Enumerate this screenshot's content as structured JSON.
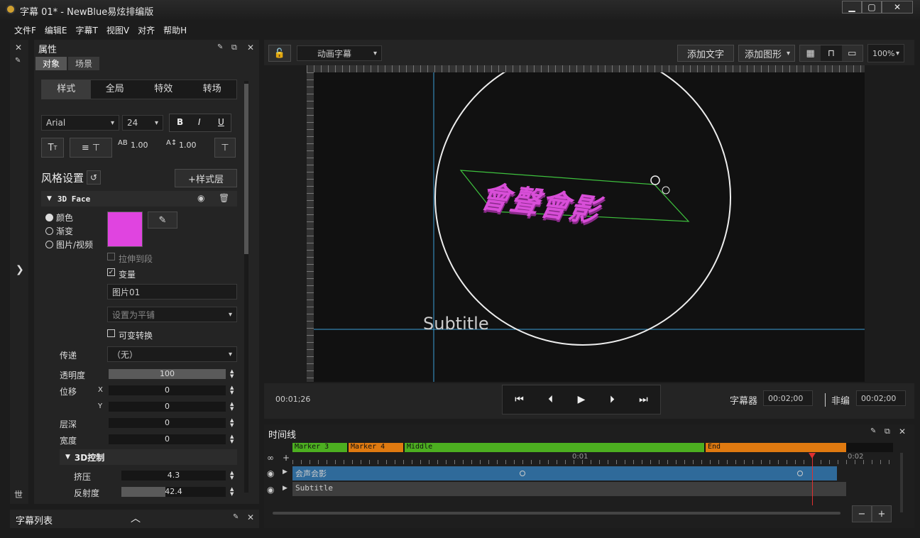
{
  "window": {
    "title": "字幕 01* - NewBlue易炫排编版",
    "min": "▁",
    "max": "▢",
    "close": "✕"
  },
  "menu": [
    "文件F",
    "编辑E",
    "字幕T",
    "视图V",
    "对齐",
    "帮助H"
  ],
  "left_strip": {
    "close": "✕",
    "pin": "✎",
    "expand": "❯",
    "bottom": "世"
  },
  "properties": {
    "title": "属性",
    "tabs": [
      "对象",
      "场景"
    ],
    "seg": [
      "样式",
      "全局",
      "特效",
      "转场"
    ],
    "font": "Arial",
    "size": "24",
    "bold": "B",
    "italic": "I",
    "underline": "U",
    "tracking": "1.00",
    "leading": "1.00",
    "style_settings": "风格设置",
    "add_layer": "+样式层",
    "face": "3D Face",
    "radio": [
      "颜色",
      "渐变",
      "图片/视频"
    ],
    "face_color": "#e044e0",
    "stretch": "拉伸到段",
    "transform": "变量",
    "image_name": "图片01",
    "tile": "设置为平铺",
    "var_convert": "可变转换",
    "pass_label": "传递",
    "pass_value": "（无）",
    "opacity_label": "透明度",
    "opacity_value": "100",
    "offset_label": "位移",
    "x_label": "X",
    "x_value": "0",
    "y_label": "Y",
    "y_value": "0",
    "depth_label": "层深",
    "depth_value": "0",
    "width_label": "宽度",
    "width_value": "0",
    "ctrl3d": "3D控制",
    "extrude_label": "挤压",
    "extrude_value": "4.3",
    "reflect_label": "反射度",
    "reflect_value": "42.4"
  },
  "subtitle_list": {
    "title": "字幕列表"
  },
  "toolbar": {
    "mode": "动画字幕",
    "add_text": "添加文字",
    "add_shape": "添加图形",
    "zoom": "100%"
  },
  "canvas": {
    "text": "Subtitle",
    "logo_text": "會聲會影"
  },
  "transport": {
    "time": "00:01;26",
    "subtitle_label": "字幕器",
    "subtitle_time": "00:02;00",
    "edit_label": "非编",
    "edit_time": "00:02;00"
  },
  "timeline": {
    "title": "时间线",
    "markers": [
      {
        "name": "Marker 3",
        "color": "#4caf20"
      },
      {
        "name": "Marker 4",
        "color": "#e07a10"
      },
      {
        "name": "Middle",
        "color": "#4caf20"
      },
      {
        "name": "End",
        "color": "#e07a10"
      }
    ],
    "ticks": [
      "0:01",
      "0:02"
    ],
    "tracks": [
      "会声会影",
      "Subtitle"
    ],
    "zoom_minus": "−",
    "zoom_plus": "+"
  }
}
